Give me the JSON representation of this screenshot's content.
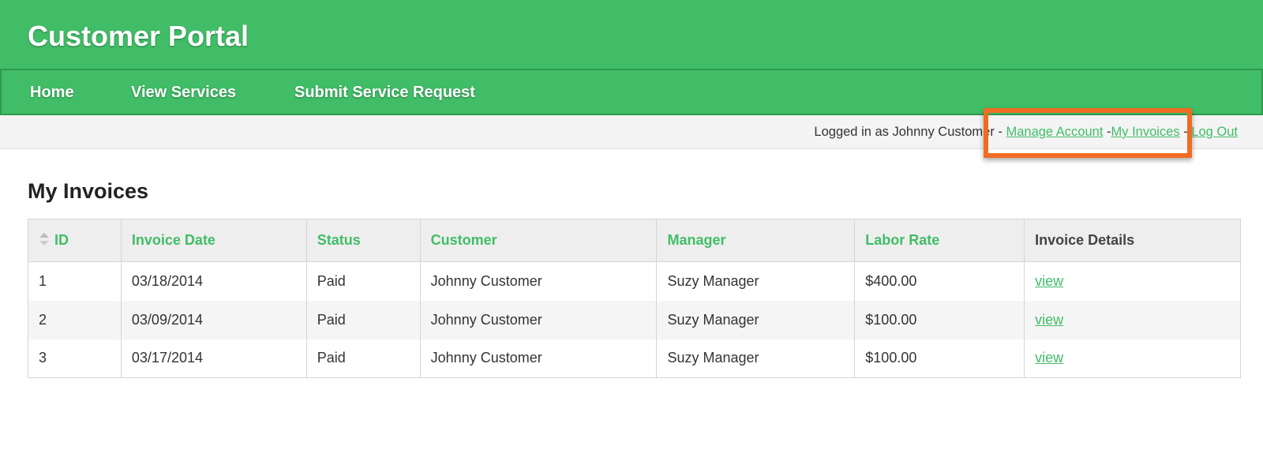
{
  "header": {
    "title": "Customer Portal"
  },
  "nav": {
    "items": [
      {
        "label": "Home"
      },
      {
        "label": "View Services"
      },
      {
        "label": "Submit Service Request"
      }
    ]
  },
  "userbar": {
    "logged_in_text": "Logged in as Johnny Customer - ",
    "manage_account": "Manage Account",
    "sep1": " -",
    "my_invoices": "My Invoices",
    "sep2": " - ",
    "logout": "Log Out"
  },
  "page": {
    "title": "My Invoices"
  },
  "table": {
    "sort_icon": "sort-icon",
    "columns": [
      "ID",
      "Invoice Date",
      "Status",
      "Customer",
      "Manager",
      "Labor Rate",
      "Invoice Details"
    ],
    "rows": [
      {
        "id": "1",
        "date": "03/18/2014",
        "status": "Paid",
        "customer": "Johnny Customer",
        "manager": "Suzy Manager",
        "rate": "$400.00",
        "details": "view"
      },
      {
        "id": "2",
        "date": "03/09/2014",
        "status": "Paid",
        "customer": "Johnny Customer",
        "manager": "Suzy Manager",
        "rate": "$100.00",
        "details": "view"
      },
      {
        "id": "3",
        "date": "03/17/2014",
        "status": "Paid",
        "customer": "Johnny Customer",
        "manager": "Suzy Manager",
        "rate": "$100.00",
        "details": "view"
      }
    ]
  },
  "colors": {
    "brand_green": "#41bd67",
    "highlight_orange": "#f26b22"
  }
}
